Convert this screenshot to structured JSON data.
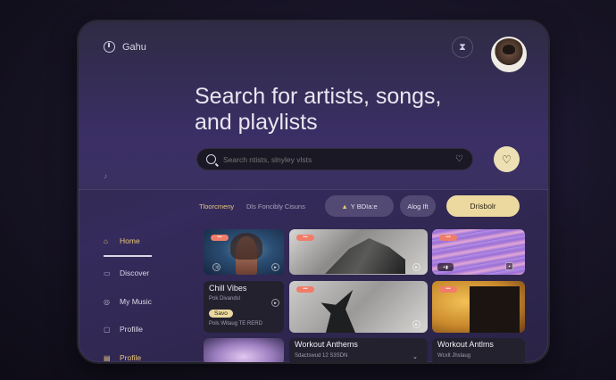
{
  "brand": {
    "name": "Gahu",
    "logo_icon": "clock-icon"
  },
  "header": {
    "notification_icon": "hourglass-icon",
    "avatar": "user-avatar"
  },
  "hero": {
    "title_line1": "Search for artists, songs,",
    "title_line2": "and playlists"
  },
  "search": {
    "placeholder": "Search ntists, slnyley vlsts",
    "favorite_icon": "heart-icon"
  },
  "sidebar": {
    "items": [
      {
        "label": "Home",
        "icon": "home-icon",
        "active": true
      },
      {
        "label": "Discover",
        "icon": "compass-icon",
        "active": false
      },
      {
        "label": "My Music",
        "icon": "music-icon",
        "active": false
      },
      {
        "label": "Profille",
        "icon": "profile-icon",
        "active": false
      },
      {
        "label": "Profile",
        "icon": "profile-icon",
        "active": true
      }
    ]
  },
  "filters": {
    "links": [
      "Tloorcmeny",
      "Dls Foncibly Cisuns"
    ],
    "pills": [
      "Y BDIa:e",
      "Alog Ift",
      "Drisbolr"
    ]
  },
  "cards": [
    {
      "title": "Chill Vibes",
      "subtitle": "Pok Divandsl",
      "button": "Savo",
      "meta": "Pols Witaug TE RERD",
      "tag": "•••"
    },
    {
      "title": "",
      "subtitle": "",
      "tag": "•••"
    },
    {
      "title": "",
      "subtitle": "",
      "tag": "•••"
    },
    {
      "title": "",
      "subtitle": "",
      "tag": "•••"
    },
    {
      "title": "",
      "subtitle": "",
      "tag": "•••"
    },
    {
      "title": "Workout Anthems",
      "subtitle": "Sdactswud 12 S3SDN",
      "tag": ""
    },
    {
      "title": "Workout Antlms",
      "subtitle": "Wcxlt Jhslaug",
      "tag": ""
    }
  ],
  "colors": {
    "accent": "#e8c77a",
    "gold_pill": "#ecd9a0",
    "tag": "#f07c6a",
    "bg": "#191528"
  }
}
